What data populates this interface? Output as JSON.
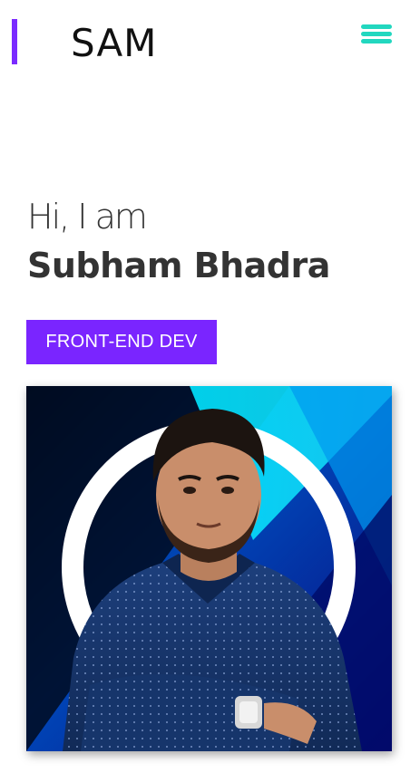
{
  "header": {
    "logo_text": "SAM",
    "menu_icon": "hamburger-menu-icon",
    "accent_color": "#7b2bff",
    "menu_color": "#22d7bf"
  },
  "hero": {
    "greeting": "Hi, I am",
    "name": "Subham Bhadra",
    "role_label": "FRONT-END DEV",
    "role_button_color": "#7a25ff"
  },
  "portrait": {
    "alt": "portrait-photo"
  }
}
